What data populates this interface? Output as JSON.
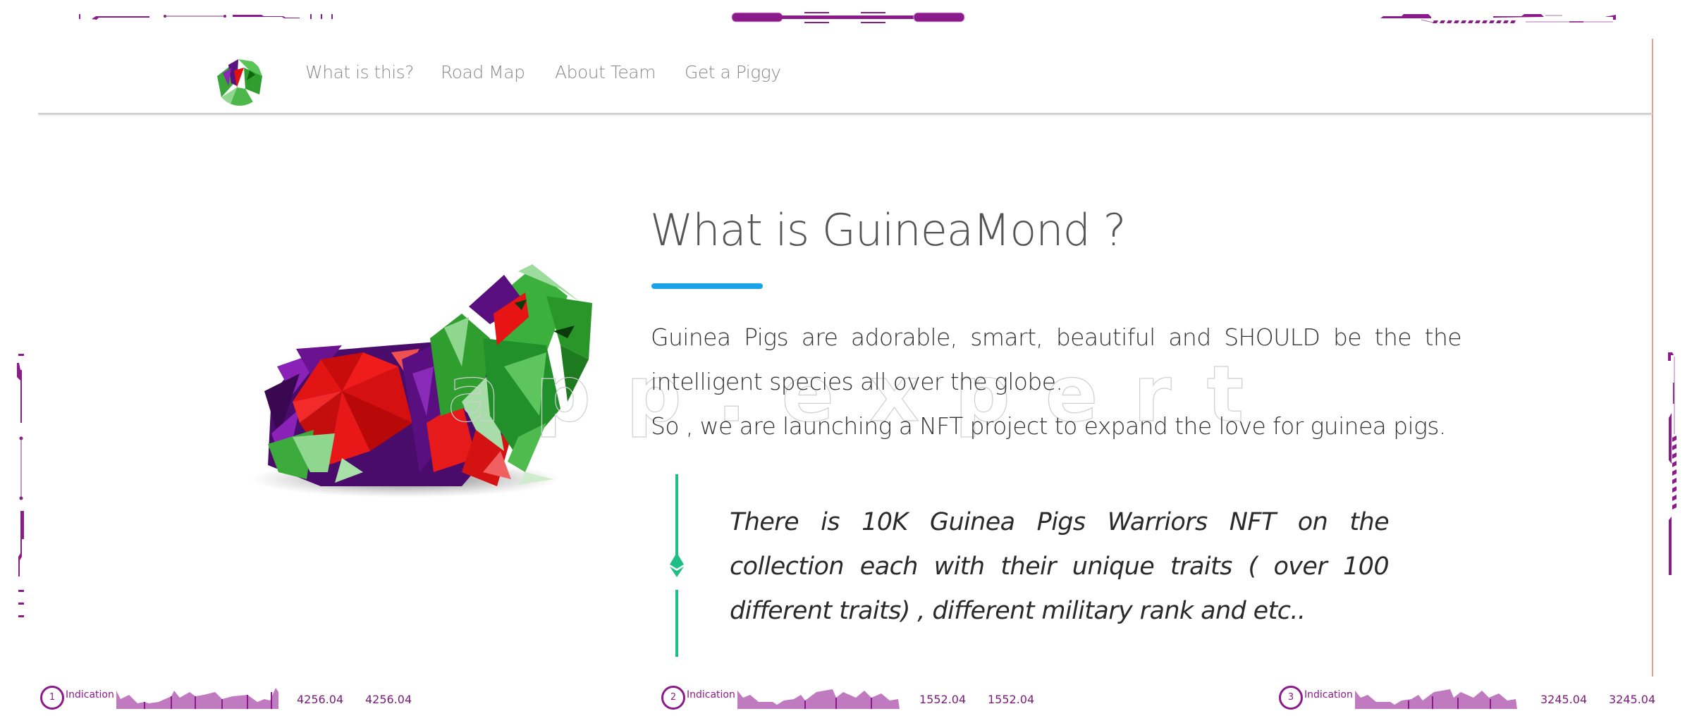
{
  "nav": {
    "logo_alt": "GuineaMond logo",
    "links": [
      {
        "label": "What is this?"
      },
      {
        "label": "Road Map"
      },
      {
        "label": "About Team"
      },
      {
        "label": "Get a Piggy"
      }
    ]
  },
  "hero": {
    "title": "What is GuineaMond ?",
    "paragraph1": "Guinea Pigs are adorable, smart, beautiful and SHOULD be the the intelligent species all over the globe.",
    "paragraph2": "So , we are launching a NFT project to expand the love for guinea pigs.",
    "quote": "There is 10K Guinea Pigs Warriors NFT on the collection each with their unique traits ( over 100 different traits) , different military rank and etc..",
    "quote_icon": "ethereum-icon",
    "image": "low-poly-guinea-pig-illustration"
  },
  "watermark": "app.expert",
  "tickers": [
    {
      "number": "1",
      "label": "Indication",
      "value_a": "4256.04",
      "value_b": "4256.04"
    },
    {
      "number": "2",
      "label": "Indication",
      "value_a": "1552.04",
      "value_b": "1552.04"
    },
    {
      "number": "3",
      "label": "Indication",
      "value_a": "3245.04",
      "value_b": "3245.04"
    }
  ],
  "colors": {
    "accent_blue": "#1aa3e8",
    "accent_green": "#1dbf84",
    "deco_purple": "#8b1a8b",
    "nav_text": "#8a8a8a"
  }
}
